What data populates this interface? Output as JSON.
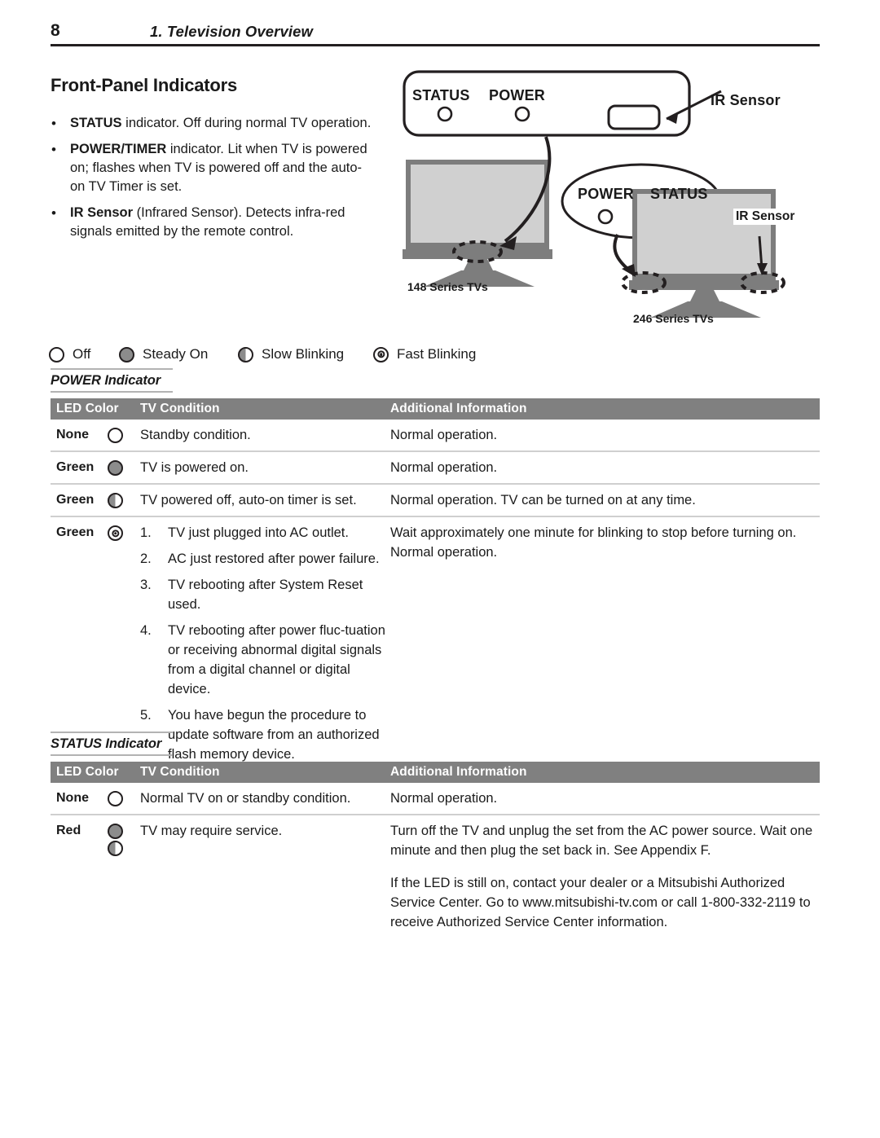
{
  "page": {
    "number": "8",
    "chapter_title": "1.  Television Overview",
    "section_heading": "Front-Panel Indicators"
  },
  "bullets": [
    {
      "marker": "•",
      "bold": "STATUS",
      "rest": " indicator.  Off during normal TV operation."
    },
    {
      "marker": "•",
      "bold": "POWER/TIMER",
      "rest": " indicator.  Lit when TV is powered on; flashes when TV is powered off and the auto-on TV Timer is set."
    },
    {
      "marker": "•",
      "bold": "IR Sensor",
      "rest": " (Infrared Sensor).  Detects infra-red signals emitted by the remote control."
    }
  ],
  "diagram": {
    "panel_bar": {
      "status_label": "STATUS",
      "power_label": "POWER",
      "ir_sensor_label": "IR Sensor"
    },
    "oval_callout": {
      "power_label": "POWER",
      "status_label": "STATUS"
    },
    "tv_left_caption": "148 Series TVs",
    "tv_right_caption": "246 Series TVs",
    "tv_right_ir_label": "IR Sensor"
  },
  "legend": [
    {
      "icon": "led-off-icon",
      "label": "Off"
    },
    {
      "icon": "led-steady-icon",
      "label": "Steady On"
    },
    {
      "icon": "led-slow-icon",
      "label": "Slow Blinking"
    },
    {
      "icon": "led-fast-icon",
      "label": "Fast Blinking"
    }
  ],
  "power_table": {
    "caption": "POWER Indicator",
    "headers": {
      "led_color": "LED Color",
      "tv_condition": "TV Condition",
      "additional_information": "Additional Information"
    },
    "rows": [
      {
        "led_color": "None",
        "led_icons": [
          "led-off-icon"
        ],
        "condition": "Standby condition.",
        "additional": [
          "Normal operation."
        ]
      },
      {
        "led_color": "Green",
        "led_icons": [
          "led-steady-icon"
        ],
        "condition": "TV is powered on.",
        "additional": [
          "Normal operation."
        ]
      },
      {
        "led_color": "Green",
        "led_icons": [
          "led-slow-icon"
        ],
        "condition": "TV powered off, auto-on timer is set.",
        "additional": [
          "Normal operation.  TV can be turned on at any time."
        ]
      },
      {
        "led_color": "Green",
        "led_icons": [
          "led-fast-icon"
        ],
        "condition_list": [
          {
            "n": "1.",
            "text": "TV just plugged into AC outlet."
          },
          {
            "n": "2.",
            "text": "AC just restored after power failure."
          },
          {
            "n": "3.",
            "text": "TV rebooting after System Reset used."
          },
          {
            "n": "4.",
            "text": "TV rebooting after power fluc-tuation or receiving abnormal digital signals from a digital channel or digital device."
          },
          {
            "n": "5.",
            "text": "You have begun the procedure to update software from an authorized flash memory device."
          }
        ],
        "additional": [
          "Wait approximately one minute for blinking to stop before turning on.  Normal operation."
        ]
      }
    ]
  },
  "status_table": {
    "caption": "STATUS Indicator",
    "headers": {
      "led_color": "LED Color",
      "tv_condition": "TV Condition",
      "additional_information": "Additional Information"
    },
    "rows": [
      {
        "led_color": "None",
        "led_icons": [
          "led-off-icon"
        ],
        "condition": "Normal TV on or standby condition.",
        "additional": [
          "Normal operation."
        ]
      },
      {
        "led_color": "Red",
        "led_icons": [
          "led-steady-icon",
          "led-slow-icon"
        ],
        "condition": "TV may require service.",
        "additional": [
          "Turn off the TV and unplug the set from the AC power source.  Wait one minute and then plug the set back in.  See Appendix F.",
          "If the LED is still on, contact your dealer or a Mitsubishi Authorized Service Center.  Go to www.mitsubishi-tv.com or call 1-800-332-2119 to receive Authorized Service Center information."
        ]
      }
    ]
  },
  "colors": {
    "header_band": "#808080",
    "rule": "#231f20",
    "row_divider": "#cfcfcf",
    "led_fill": "#8c8c8c",
    "tv_screen": "#d0d0d0",
    "tv_body": "#7d7d7d"
  }
}
